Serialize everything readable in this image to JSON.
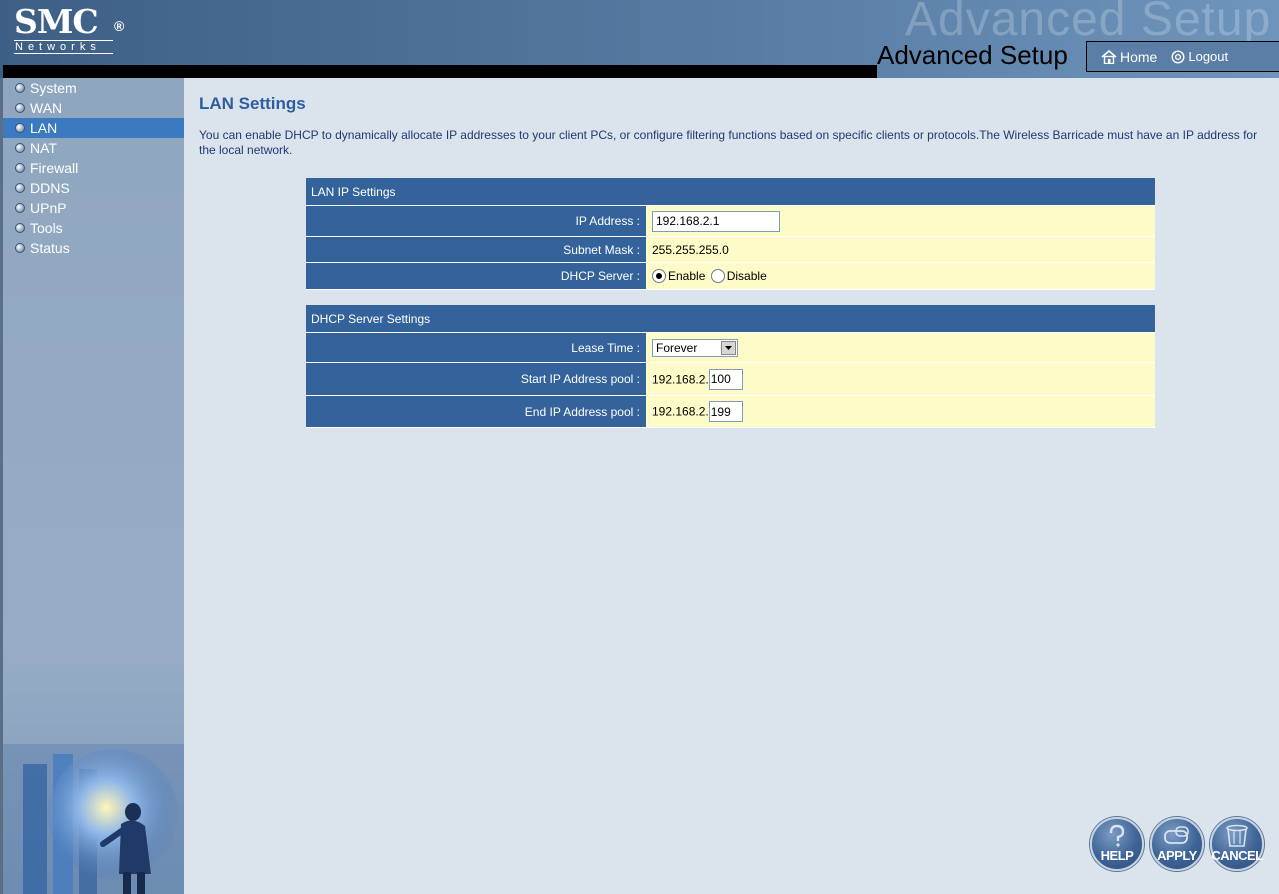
{
  "header": {
    "logo_main": "SMC",
    "logo_registered": "®",
    "logo_sub": "Networks",
    "watermark": "Advanced Setup",
    "title": "Advanced Setup",
    "home_label": "Home",
    "logout_label": "Logout"
  },
  "sidebar": {
    "items": [
      {
        "label": "System",
        "active": false
      },
      {
        "label": "WAN",
        "active": false
      },
      {
        "label": "LAN",
        "active": true
      },
      {
        "label": "NAT",
        "active": false
      },
      {
        "label": "Firewall",
        "active": false
      },
      {
        "label": "DDNS",
        "active": false
      },
      {
        "label": "UPnP",
        "active": false
      },
      {
        "label": "Tools",
        "active": false
      },
      {
        "label": "Status",
        "active": false
      }
    ]
  },
  "main": {
    "title": "LAN Settings",
    "description": "You can enable DHCP to dynamically allocate IP addresses to your client PCs, or configure filtering functions based on specific clients or protocols.The Wireless Barricade must have an IP address for the local network.",
    "lan_ip": {
      "section_title": "LAN IP Settings",
      "ip_label": "IP Address :",
      "ip_value": "192.168.2.1",
      "subnet_label": "Subnet Mask :",
      "subnet_value": "255.255.255.0",
      "dhcp_label": "DHCP Server :",
      "enable_label": "Enable",
      "disable_label": "Disable",
      "dhcp_selected": "Enable"
    },
    "dhcp_settings": {
      "section_title": "DHCP Server Settings",
      "lease_label": "Lease Time :",
      "lease_value": "Forever",
      "start_label": "Start IP Address pool :",
      "start_prefix": "192.168.2.",
      "start_value": "100",
      "end_label": "End IP Address pool :",
      "end_prefix": "192.168.2.",
      "end_value": "199"
    }
  },
  "buttons": {
    "help": "HELP",
    "apply": "APPLY",
    "cancel": "CANCEL"
  },
  "colors": {
    "header_blue": "#3e5f85",
    "table_label_blue": "#33639a",
    "table_value_yellow": "#fdfbc8",
    "active_nav": "#3b79c0",
    "page_background": "#dbe3ec"
  }
}
